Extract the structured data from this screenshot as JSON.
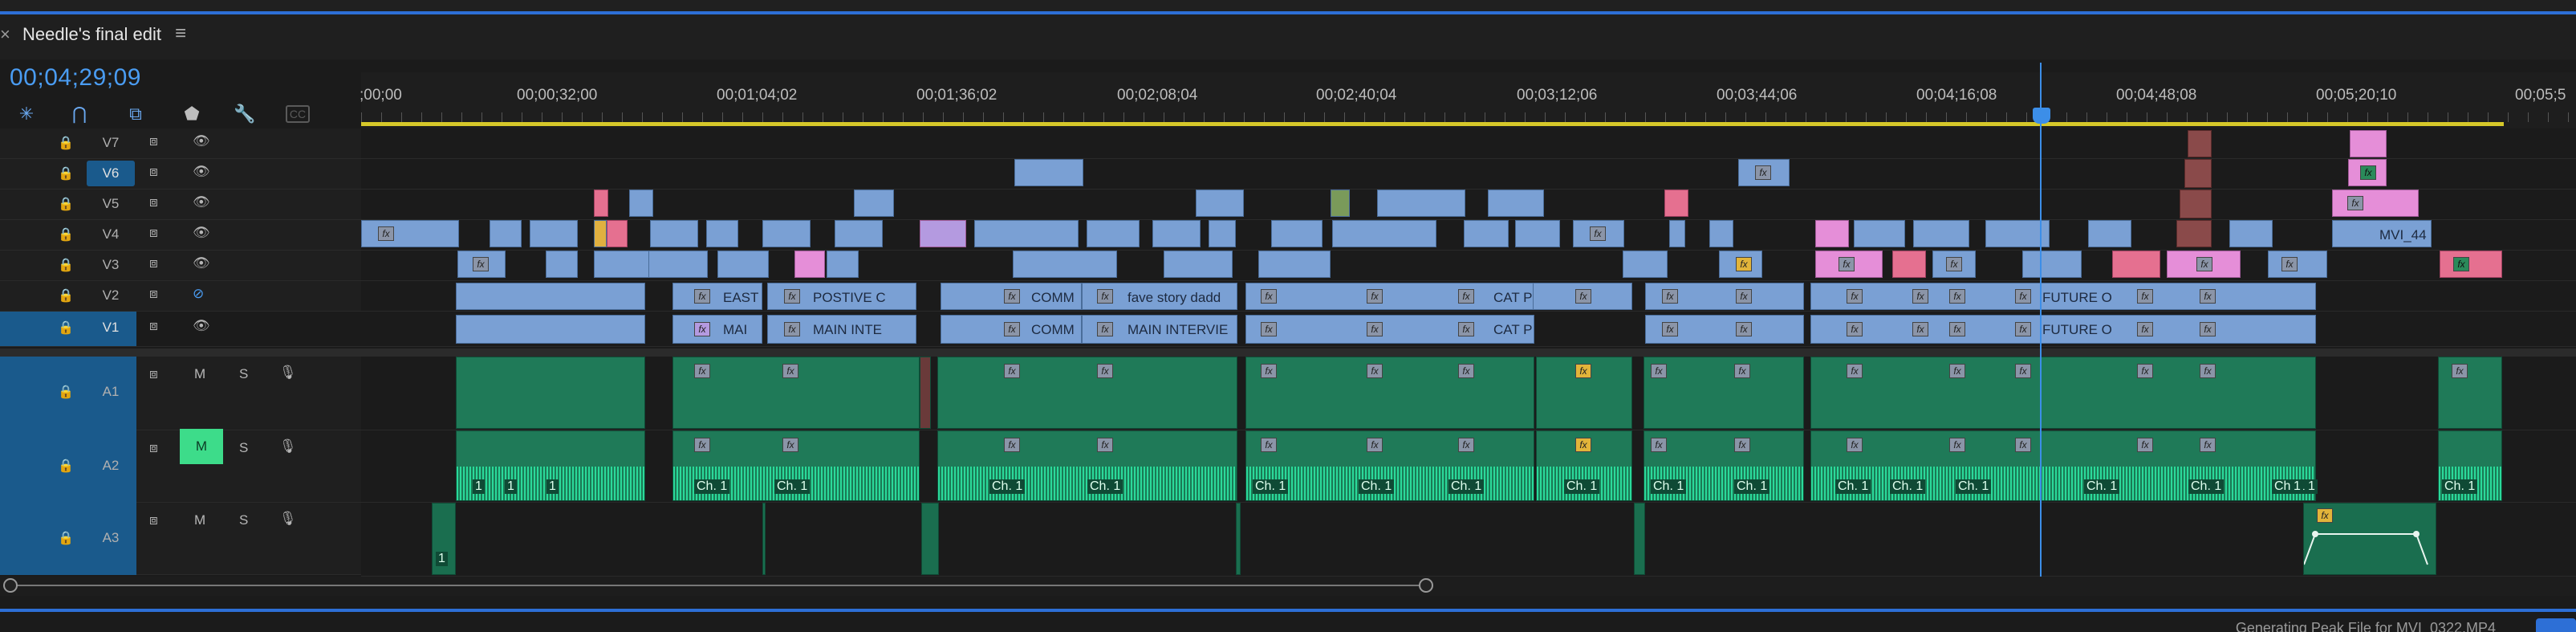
{
  "window": {
    "close": "×",
    "title": "Needle's final edit",
    "menu": "≡"
  },
  "timecode": "00;04;29;09",
  "ruler": {
    "ticks": [
      ";00;00",
      "00;00;32;00",
      "00;01;04;02",
      "00;01;36;02",
      "00;02;08;04",
      "00;02;40;04",
      "00;03;12;06",
      "00;03;44;06",
      "00;04;16;08",
      "00;04;48;08",
      "00;05;20;10",
      "00;05;5"
    ]
  },
  "tracks": {
    "video": [
      {
        "name": "V7",
        "active": false
      },
      {
        "name": "V6",
        "active": true
      },
      {
        "name": "V5",
        "active": false
      },
      {
        "name": "V4",
        "active": false
      },
      {
        "name": "V3",
        "active": false
      },
      {
        "name": "V2",
        "active": false
      },
      {
        "name": "V1",
        "active": true
      }
    ],
    "audio": [
      {
        "name": "A1",
        "m": "M",
        "s": "S"
      },
      {
        "name": "A2",
        "m": "M",
        "s": "S"
      },
      {
        "name": "A3",
        "m": "M",
        "s": "S"
      }
    ]
  },
  "clips": {
    "v4_mvi": "MVI_44",
    "v2": [
      "EAST",
      "POSTIVE C",
      "COMM",
      "fave story dadd",
      "CAT P",
      "FUTURE O"
    ],
    "v1": [
      "MAI",
      "MAIN INTE",
      "COMM",
      "MAIN INTERVIE",
      "CAT P",
      "FUTURE O"
    ],
    "fx": "fx",
    "a3_label": "1",
    "ch_labels": [
      "1",
      "1",
      "1",
      "Ch. 1",
      "Ch. 1",
      "Ch. 1",
      "Ch. 1",
      "Ch. 1",
      "Ch. 1",
      "Ch. 1",
      "Ch. 1",
      "Ch. 1",
      "Ch. 1",
      "Ch. 1",
      "Ch. 1",
      "Ch. 1",
      "Ch. 1",
      "Ch. 1",
      "Ch. 1",
      "1",
      "1",
      "Ch. 1"
    ]
  },
  "status": "Generating Peak File for MVI_0322.MP4",
  "colors": {
    "accent": "#2d6fd6",
    "video_clip": "#7aa0d4",
    "pink_clip": "#e58ed8",
    "audio_clip": "#1f7a58",
    "wave": "#2bd99a"
  }
}
